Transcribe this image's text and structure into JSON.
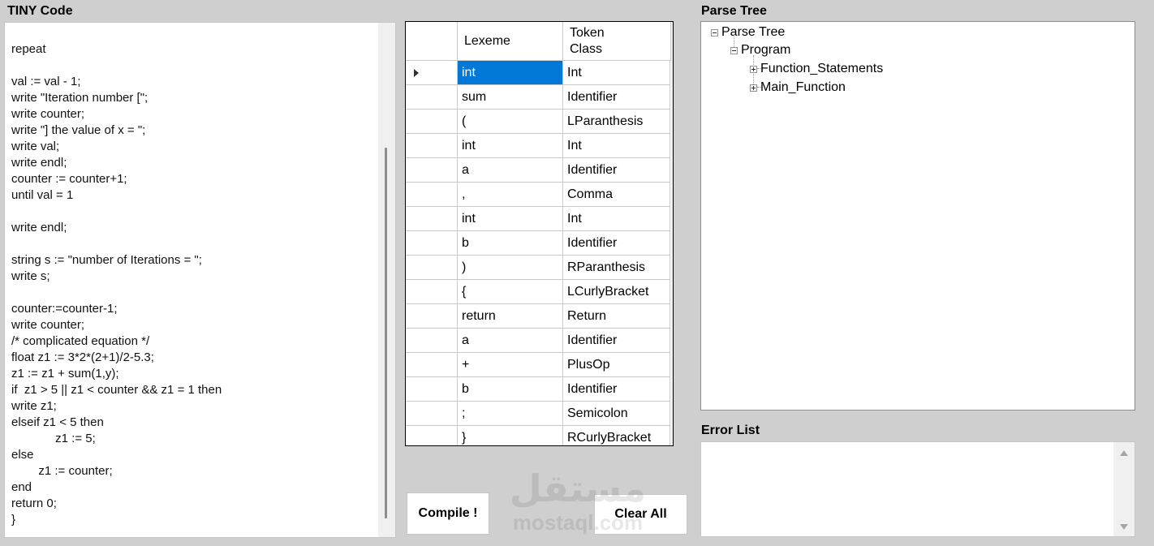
{
  "code_panel": {
    "title": "TINY Code",
    "text": "\nrepeat\n\nval := val - 1;\nwrite \"Iteration number [\";\nwrite counter;\nwrite \"] the value of x = \";\nwrite val;\nwrite endl;\ncounter := counter+1;\nuntil val = 1\n\nwrite endl;\n\nstring s := \"number of Iterations = \";\nwrite s;\n\ncounter:=counter-1;\nwrite counter;\n/* complicated equation */\nfloat z1 := 3*2*(2+1)/2-5.3;\nz1 := z1 + sum(1,y);\nif  z1 > 5 || z1 < counter && z1 = 1 then\nwrite z1;\nelseif z1 < 5 then\n             z1 := 5;\nelse\n        z1 := counter;\nend\nreturn 0;\n}"
  },
  "token_table": {
    "columns": [
      "Lexeme",
      "Token\nClass"
    ],
    "selected_row": 0,
    "rows": [
      {
        "lexeme": "int",
        "token_class": "Int"
      },
      {
        "lexeme": "sum",
        "token_class": "Identifier"
      },
      {
        "lexeme": "(",
        "token_class": "LParanthesis"
      },
      {
        "lexeme": "int",
        "token_class": "Int"
      },
      {
        "lexeme": "a",
        "token_class": "Identifier"
      },
      {
        "lexeme": ",",
        "token_class": "Comma"
      },
      {
        "lexeme": "int",
        "token_class": "Int"
      },
      {
        "lexeme": "b",
        "token_class": "Identifier"
      },
      {
        "lexeme": ")",
        "token_class": "RParanthesis"
      },
      {
        "lexeme": "{",
        "token_class": "LCurlyBracket"
      },
      {
        "lexeme": "return",
        "token_class": "Return"
      },
      {
        "lexeme": "a",
        "token_class": "Identifier"
      },
      {
        "lexeme": "+",
        "token_class": "PlusOp"
      },
      {
        "lexeme": "b",
        "token_class": "Identifier"
      },
      {
        "lexeme": ";",
        "token_class": "Semicolon"
      },
      {
        "lexeme": "}",
        "token_class": "RCurlyBracket"
      }
    ]
  },
  "buttons": {
    "compile": "Compile !",
    "clear_all": "Clear All"
  },
  "watermark": {
    "arabic": "مستقل",
    "latin": "mostaql.com"
  },
  "parse_tree": {
    "title": "Parse Tree",
    "root": "Parse Tree",
    "program": "Program",
    "children": [
      "Function_Statements",
      "Main_Function"
    ]
  },
  "error_list": {
    "title": "Error List"
  }
}
